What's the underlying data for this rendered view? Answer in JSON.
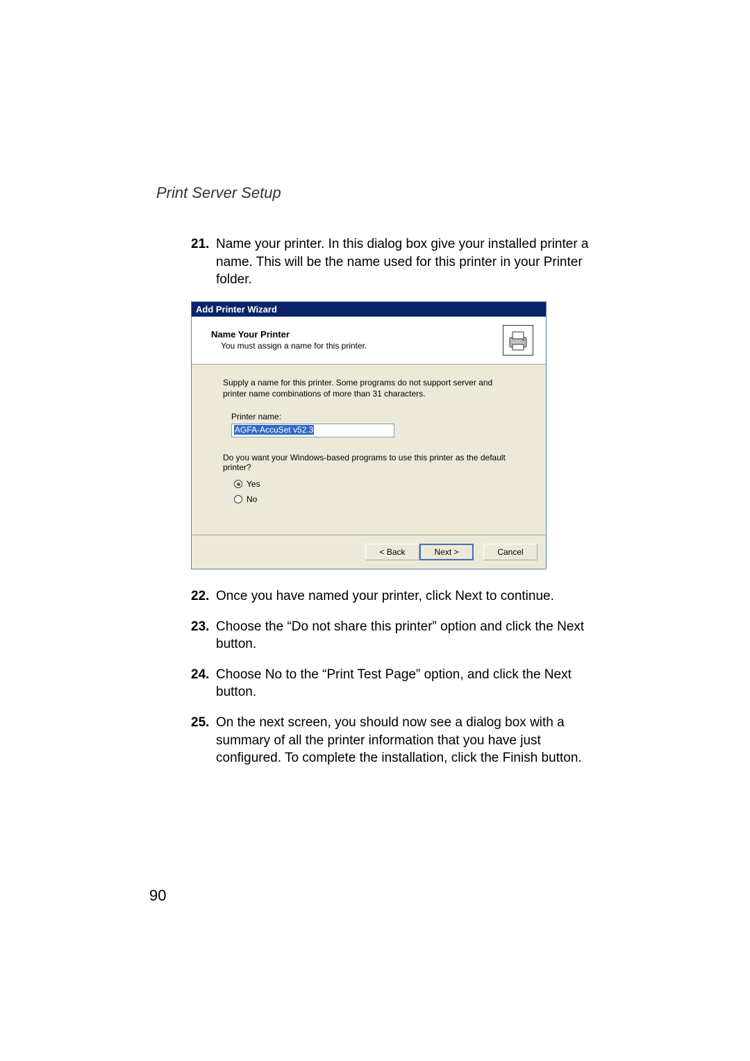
{
  "section_heading": "Print Server Setup",
  "steps": {
    "s21": {
      "num": "21.",
      "text": "Name your printer. In this dialog box give your installed printer a name. This will be the name used for this printer in your Printer folder."
    },
    "s22": {
      "num": "22.",
      "text": "Once you have named your printer, click Next to continue."
    },
    "s23": {
      "num": "23.",
      "text": "Choose the “Do not share this printer” option and click the Next button."
    },
    "s24": {
      "num": "24.",
      "text": "Choose No to the “Print Test Page” option, and click the Next button."
    },
    "s25": {
      "num": "25.",
      "text": "On the next screen, you should now see a dialog box with a summary of all the printer information that you have just configured. To complete the installation, click the Finish button."
    }
  },
  "wizard": {
    "titlebar": "Add Printer Wizard",
    "header_title": "Name Your Printer",
    "header_sub": "You must assign a name for this printer.",
    "instr": "Supply a name for this printer. Some programs do not support server and printer name combinations of more than 31 characters.",
    "printer_name_label": "Printer name:",
    "printer_name_value": "AGFA-AccuSet v52.3",
    "default_question": "Do you want your Windows-based programs to use this printer as the default printer?",
    "radio_yes": "Yes",
    "radio_no": "No",
    "btn_back": "< Back",
    "btn_next": "Next >",
    "btn_cancel": "Cancel"
  },
  "page_number": "90"
}
